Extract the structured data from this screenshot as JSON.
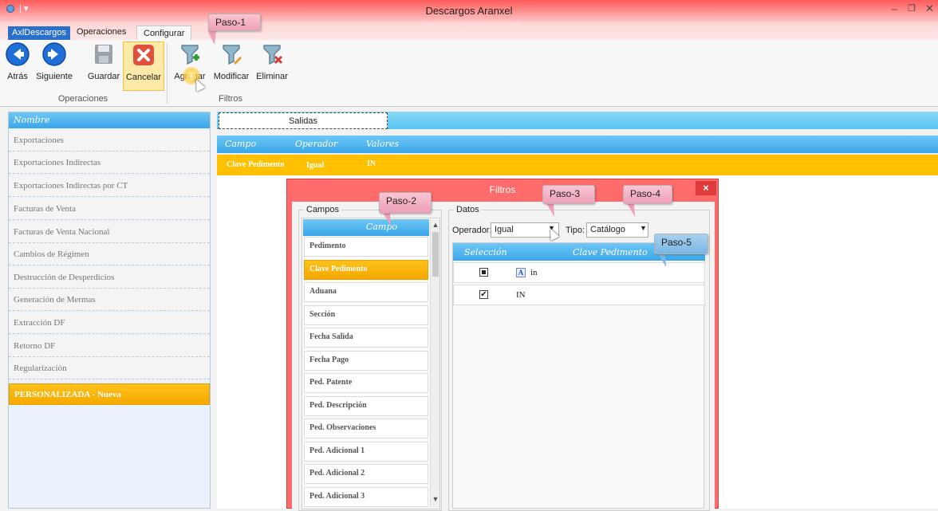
{
  "window": {
    "title": "Descargos Aranxel",
    "quick_access": "|  ▾",
    "minimize": "–",
    "maximize": "❐",
    "close": "✕"
  },
  "ribbon": {
    "tabs": [
      "AxlDescargos",
      "Operaciones",
      "Configurar"
    ],
    "active_tab": "Configurar",
    "groups": {
      "operaciones": {
        "label": "Operaciones",
        "buttons": [
          "Atrás",
          "Siguiente",
          "Guardar",
          "Cancelar"
        ]
      },
      "filtros": {
        "label": "Filtros",
        "buttons": [
          "Agregar",
          "Modificar",
          "Eliminar"
        ]
      }
    }
  },
  "callouts": [
    "Paso-1",
    "Paso-2",
    "Paso-3",
    "Paso-4",
    "Paso-5"
  ],
  "left_panel": {
    "header": "Nombre",
    "items": [
      "Exportaciones",
      "Exportaciones Indirectas",
      "Exportaciones Indirectas por CT",
      "Facturas de Venta",
      "Facturas de Venta Nacional",
      "Cambios de Régimen",
      "Destrucción de Desperdicios",
      "Generación de Mermas",
      "Extracción DF",
      "Retorno DF",
      "Regularización",
      "PERSONALIZADA - Nueva"
    ],
    "selected": "PERSONALIZADA - Nueva"
  },
  "main": {
    "tab": "Salidas",
    "grid_headers": [
      "Campo",
      "Operador",
      "Valores"
    ],
    "rows": [
      {
        "campo": "Clave Pedimento",
        "operador": "Igual",
        "valores": "IN"
      }
    ]
  },
  "dialog": {
    "title": "Filtros",
    "close": "×",
    "campos": {
      "label": "Campos",
      "header": "Campo",
      "items": [
        "Pedimento",
        "Clave Pedimento",
        "Aduana",
        "Sección",
        "Fecha Salida",
        "Fecha Pago",
        "Ped. Patente",
        "Ped. Descripción",
        "Ped. Observaciones",
        "Ped. Adicional 1",
        "Ped. Adicional 2",
        "Ped. Adicional 3"
      ],
      "selected": "Clave Pedimento"
    },
    "datos": {
      "label": "Datos",
      "operador_label": "Operador:",
      "operador_value": "Igual",
      "tipo_label": "Tipo:",
      "tipo_value": "Catálogo",
      "grid_headers": [
        "Selección",
        "Clave Pedimento"
      ],
      "rows": [
        {
          "checked": "partial",
          "value": "in",
          "icon": "text-filter-icon"
        },
        {
          "checked": "true",
          "value": "IN"
        }
      ]
    }
  },
  "colors": {
    "titlebar": "#ff5a5a",
    "header_blue": "#3aa6e8",
    "selected_orange": "#f5a800",
    "dialog_red": "#ff6b6b"
  }
}
